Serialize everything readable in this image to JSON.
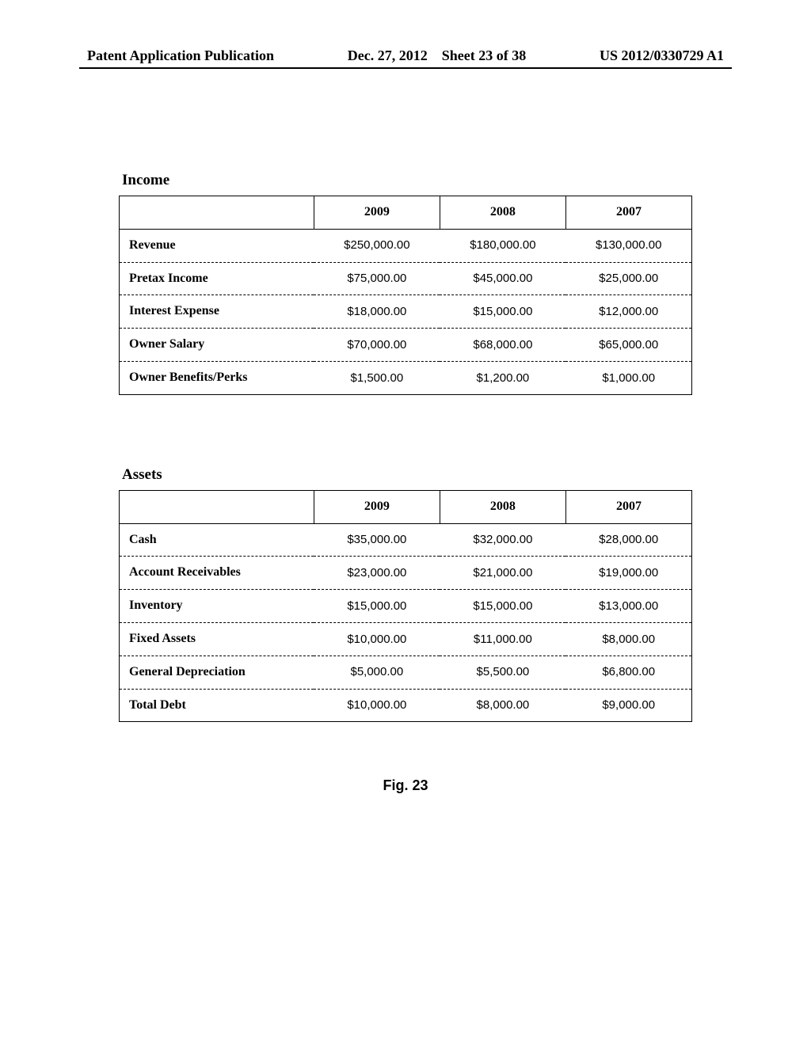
{
  "header": {
    "publication": "Patent Application Publication",
    "date": "Dec. 27, 2012",
    "sheet": "Sheet 23 of 38",
    "doc_number": "US 2012/0330729 A1"
  },
  "income": {
    "title": "Income",
    "years": [
      "2009",
      "2008",
      "2007"
    ],
    "rows": [
      {
        "label": "Revenue",
        "values": [
          "$250,000.00",
          "$180,000.00",
          "$130,000.00"
        ]
      },
      {
        "label": "Pretax Income",
        "values": [
          "$75,000.00",
          "$45,000.00",
          "$25,000.00"
        ]
      },
      {
        "label": "Interest Expense",
        "values": [
          "$18,000.00",
          "$15,000.00",
          "$12,000.00"
        ]
      },
      {
        "label": "Owner Salary",
        "values": [
          "$70,000.00",
          "$68,000.00",
          "$65,000.00"
        ]
      },
      {
        "label": "Owner Benefits/Perks",
        "values": [
          "$1,500.00",
          "$1,200.00",
          "$1,000.00"
        ]
      }
    ]
  },
  "assets": {
    "title": "Assets",
    "years": [
      "2009",
      "2008",
      "2007"
    ],
    "rows": [
      {
        "label": "Cash",
        "values": [
          "$35,000.00",
          "$32,000.00",
          "$28,000.00"
        ]
      },
      {
        "label": "Account Receivables",
        "values": [
          "$23,000.00",
          "$21,000.00",
          "$19,000.00"
        ]
      },
      {
        "label": "Inventory",
        "values": [
          "$15,000.00",
          "$15,000.00",
          "$13,000.00"
        ]
      },
      {
        "label": "Fixed Assets",
        "values": [
          "$10,000.00",
          "$11,000.00",
          "$8,000.00"
        ]
      },
      {
        "label": "General Depreciation",
        "values": [
          "$5,000.00",
          "$5,500.00",
          "$6,800.00"
        ]
      },
      {
        "label": "Total Debt",
        "values": [
          "$10,000.00",
          "$8,000.00",
          "$9,000.00"
        ]
      }
    ]
  },
  "figure_caption": "Fig. 23",
  "chart_data": [
    {
      "type": "table",
      "title": "Income",
      "categories": [
        "2009",
        "2008",
        "2007"
      ],
      "series": [
        {
          "name": "Revenue",
          "values": [
            250000.0,
            180000.0,
            130000.0
          ]
        },
        {
          "name": "Pretax Income",
          "values": [
            75000.0,
            45000.0,
            25000.0
          ]
        },
        {
          "name": "Interest Expense",
          "values": [
            18000.0,
            15000.0,
            12000.0
          ]
        },
        {
          "name": "Owner Salary",
          "values": [
            70000.0,
            68000.0,
            65000.0
          ]
        },
        {
          "name": "Owner Benefits/Perks",
          "values": [
            1500.0,
            1200.0,
            1000.0
          ]
        }
      ]
    },
    {
      "type": "table",
      "title": "Assets",
      "categories": [
        "2009",
        "2008",
        "2007"
      ],
      "series": [
        {
          "name": "Cash",
          "values": [
            35000.0,
            32000.0,
            28000.0
          ]
        },
        {
          "name": "Account Receivables",
          "values": [
            23000.0,
            21000.0,
            19000.0
          ]
        },
        {
          "name": "Inventory",
          "values": [
            15000.0,
            15000.0,
            13000.0
          ]
        },
        {
          "name": "Fixed Assets",
          "values": [
            10000.0,
            11000.0,
            8000.0
          ]
        },
        {
          "name": "General Depreciation",
          "values": [
            5000.0,
            5500.0,
            6800.0
          ]
        },
        {
          "name": "Total Debt",
          "values": [
            10000.0,
            8000.0,
            9000.0
          ]
        }
      ]
    }
  ]
}
